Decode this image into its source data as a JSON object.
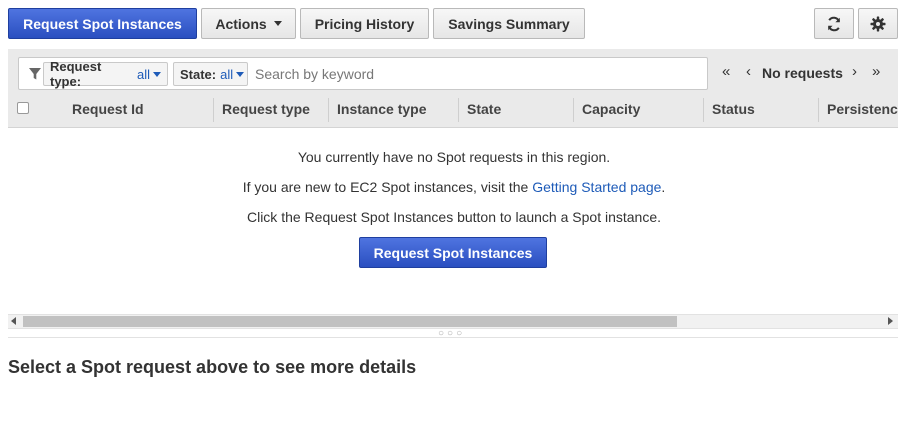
{
  "toolbar": {
    "request_button": "Request Spot Instances",
    "actions_button": "Actions",
    "pricing_history_button": "Pricing History",
    "savings_summary_button": "Savings Summary"
  },
  "filters": {
    "request_type_label": "Request type:",
    "request_type_value": "all",
    "state_label": "State:",
    "state_value": "all",
    "search_placeholder": "Search by keyword"
  },
  "pagination": {
    "first": "«",
    "prev": "‹",
    "label": "No requests",
    "next": "›",
    "last": "»"
  },
  "table": {
    "columns": [
      "Request Id",
      "Request type",
      "Instance type",
      "State",
      "Capacity",
      "Status",
      "Persistence"
    ]
  },
  "empty_state": {
    "line1": "You currently have no Spot requests in this region.",
    "line2_prefix": "If you are new to EC2 Spot instances, visit the ",
    "line2_link": "Getting Started page",
    "line2_suffix": ".",
    "line3": "Click the Request Spot Instances button to launch a Spot instance.",
    "button": "Request Spot Instances"
  },
  "details": {
    "title": "Select a Spot request above to see more details"
  },
  "icons": {
    "refresh": "refresh-icon",
    "settings": "gear-icon",
    "filter": "filter-icon"
  },
  "colors": {
    "primary": "#2f55c8",
    "link": "#1e5bb8"
  }
}
